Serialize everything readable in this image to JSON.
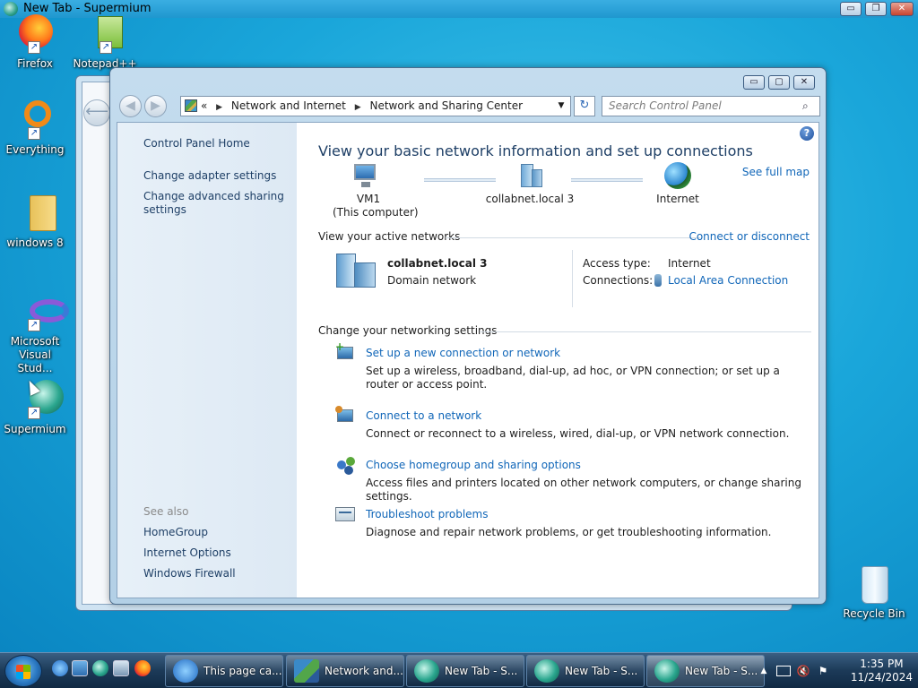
{
  "browser_window": {
    "title": "New Tab - Supermium",
    "controls": {
      "minimize": "▭",
      "maximize": "❐",
      "close": "✕"
    }
  },
  "desktop_icons": [
    {
      "label": "Firefox",
      "icon": "firefox-icon"
    },
    {
      "label": "Notepad++",
      "icon": "notepad-plus-plus-icon"
    },
    {
      "label": "Everything",
      "icon": "everything-search-icon"
    },
    {
      "label": "windows 8",
      "icon": "folder-icon"
    },
    {
      "label": "Microsoft Visual Stud...",
      "icon": "visual-studio-icon"
    },
    {
      "label": "Supermium",
      "icon": "supermium-icon"
    },
    {
      "label": "Recycle Bin",
      "icon": "recycle-bin-icon"
    }
  ],
  "main_window": {
    "controls": {
      "minimize": "▭",
      "maximize": "▢",
      "close": "✕"
    },
    "address": {
      "prefix": "«",
      "crumbs": [
        "Network and Internet",
        "Network and Sharing Center"
      ],
      "separator": "▶",
      "dropdown": "▼"
    },
    "refresh_glyph": "↻",
    "search": {
      "placeholder": "Search Control Panel",
      "glyph": "⌕"
    },
    "left_pane": {
      "home": "Control Panel Home",
      "links": [
        "Change adapter settings",
        "Change advanced sharing settings"
      ],
      "see_also_header": "See also",
      "see_also": [
        "HomeGroup",
        "Internet Options",
        "Windows Firewall"
      ]
    },
    "content": {
      "title": "View your basic network information and set up connections",
      "help_glyph": "?",
      "see_full_map": "See full map",
      "map_nodes": [
        {
          "name": "VM1",
          "sub": "(This computer)",
          "icon": "computer-icon"
        },
        {
          "name": "collabnet.local  3",
          "sub": "",
          "icon": "domain-network-icon"
        },
        {
          "name": "Internet",
          "sub": "",
          "icon": "globe-icon"
        }
      ],
      "active_networks_header": "View your active networks",
      "connect_disconnect": "Connect or disconnect",
      "active_network": {
        "name": "collabnet.local  3",
        "type": "Domain network",
        "access_type_label": "Access type:",
        "access_type_value": "Internet",
        "connections_label": "Connections:",
        "connections_value": "Local Area Connection"
      },
      "change_settings_header": "Change your networking settings",
      "tasks": [
        {
          "title": "Set up a new connection or network",
          "desc": "Set up a wireless, broadband, dial-up, ad hoc, or VPN connection; or set up a router or access point.",
          "icon": "new-connection-icon"
        },
        {
          "title": "Connect to a network",
          "desc": "Connect or reconnect to a wireless, wired, dial-up, or VPN network connection.",
          "icon": "connect-network-icon"
        },
        {
          "title": "Choose homegroup and sharing options",
          "desc": "Access files and printers located on other network computers, or change sharing settings.",
          "icon": "homegroup-icon"
        },
        {
          "title": "Troubleshoot problems",
          "desc": "Diagnose and repair network problems, or get troubleshooting information.",
          "icon": "troubleshoot-icon"
        }
      ]
    }
  },
  "taskbar": {
    "buttons": [
      {
        "label": "This page ca...",
        "icon": "internet-explorer-icon"
      },
      {
        "label": "Network and...",
        "icon": "network-center-icon"
      },
      {
        "label": "New Tab - S...",
        "icon": "supermium-icon"
      },
      {
        "label": "New Tab - S...",
        "icon": "supermium-icon"
      },
      {
        "label": "New Tab - S...",
        "icon": "supermium-icon"
      }
    ],
    "tray": {
      "expand_glyph": "▲",
      "time": "1:35 PM",
      "date": "11/24/2024"
    }
  },
  "colors": {
    "link": "#1066b8",
    "title": "#1e3f66",
    "desktop": "#1aa6da"
  }
}
